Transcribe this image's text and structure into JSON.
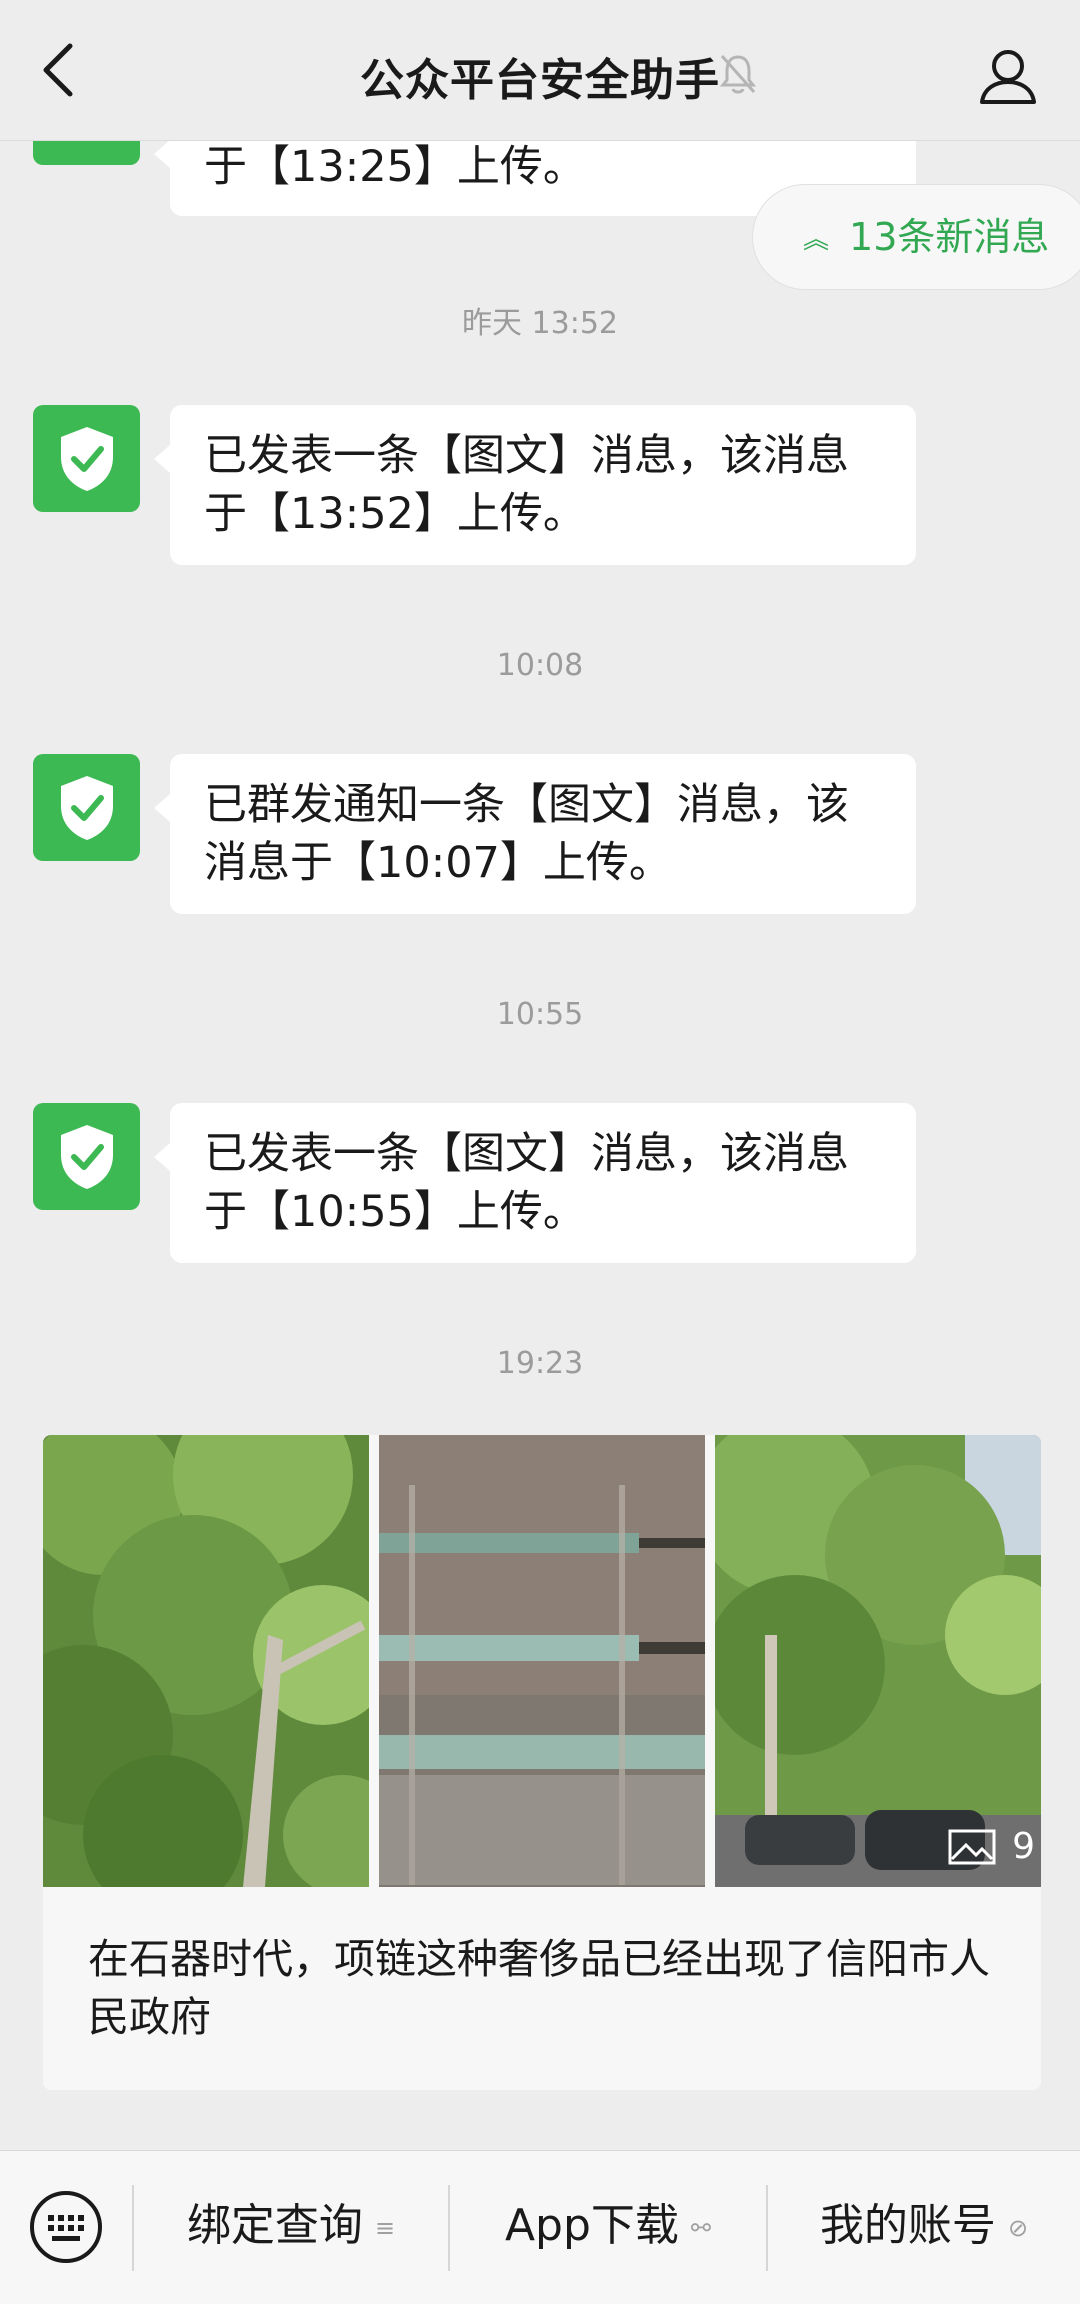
{
  "header": {
    "title": "公众平台安全助手"
  },
  "new_messages": {
    "label": "13条新消息"
  },
  "messages": [
    {
      "text": "于【13:25】上传。"
    },
    {
      "time": "昨天 13:52",
      "text": "已发表一条【图文】消息，该消息于【13:52】上传。"
    },
    {
      "time": "10:08",
      "text": "已群发通知一条【图文】消息，该消息于【10:07】上传。"
    },
    {
      "time": "10:55",
      "text": "已发表一条【图文】消息，该消息于【10:55】上传。"
    }
  ],
  "card": {
    "time": "19:23",
    "image_count": "9",
    "title": "在石器时代，项链这种奢侈品已经出现了信阳市人民政府"
  },
  "menu": [
    {
      "label": "绑定查询",
      "icon": "list-icon"
    },
    {
      "label": "App下载",
      "icon": "link-icon"
    },
    {
      "label": "我的账号",
      "icon": "mini-program-icon"
    }
  ],
  "colors": {
    "accent": "#3db953",
    "new_message_text": "#32a852",
    "background": "#ededed"
  }
}
